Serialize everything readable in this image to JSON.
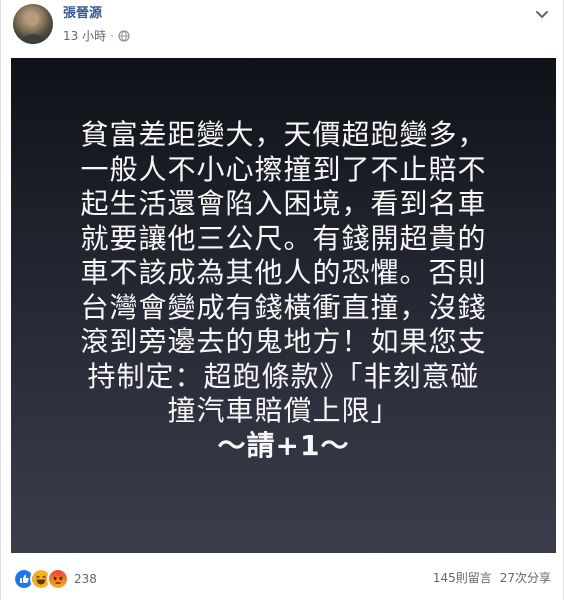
{
  "post": {
    "author": "張晉源",
    "time": "13 小時",
    "separator": "·",
    "privacy_icon": "globe-icon",
    "menu_icon": "chevron-down-icon"
  },
  "image_text": {
    "lines": [
      "貧富差距變大，天價超跑變多，",
      "一般人不小心擦撞到了不止賠不",
      "起生活還會陷入困境，看到名車",
      "就要讓他三公尺。有錢開超貴的",
      "車不該成為其他人的恐懼。否則",
      "台灣會變成有錢橫衝直撞，沒錢",
      "滾到旁邊去的鬼地方！如果您支",
      "持制定：超跑條款》「非刻意碰",
      "撞汽車賠償上限」",
      "〜請+1〜"
    ],
    "text_color": "#f7f7f7"
  },
  "footer": {
    "reaction_icons": [
      "like-icon",
      "haha-icon",
      "angry-icon"
    ],
    "reaction_count": "238",
    "comments": "145則留言",
    "shares": "27次分享"
  },
  "colors": {
    "author": "#385898",
    "meta": "#616770",
    "like": "#1877f2",
    "haha": "#f7b125",
    "angry": "#e9710f"
  }
}
